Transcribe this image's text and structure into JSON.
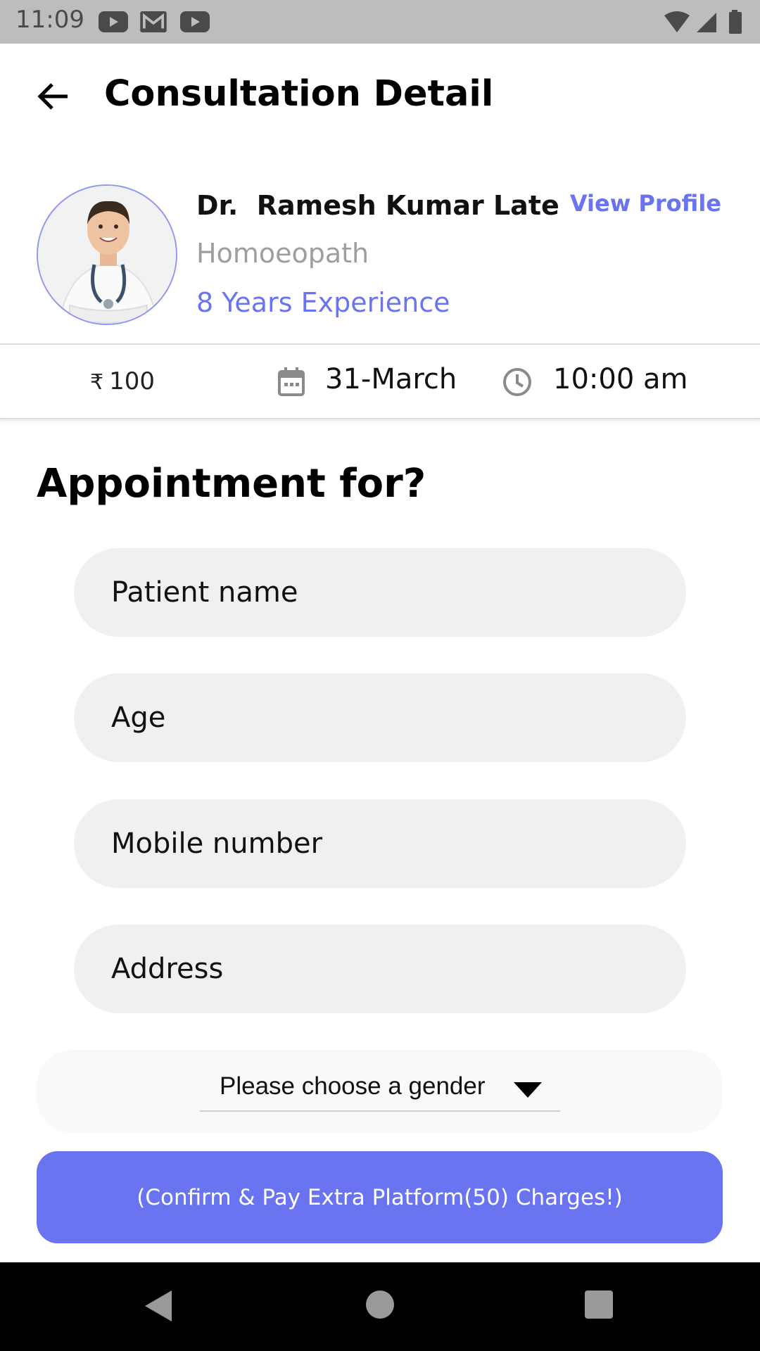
{
  "status_bar": {
    "time": "11:09",
    "left_icons": [
      "youtube-icon",
      "gmail-icon",
      "youtube-icon"
    ],
    "right_icons": [
      "wifi-icon",
      "cellular-signal-icon",
      "battery-icon"
    ]
  },
  "header": {
    "title": "Consultation Detail",
    "back_icon": "arrow-left-icon"
  },
  "doctor": {
    "name": "Dr.  Ramesh Kumar Late",
    "specialty": "Homoeopath",
    "experience": "8 Years Experience",
    "view_profile_label": "View Profile"
  },
  "consultation": {
    "currency_symbol": "₹",
    "fee": "100",
    "date": "31-March",
    "time": "10:00 am"
  },
  "form": {
    "heading": "Appointment for?",
    "patient_name_placeholder": "Patient name",
    "age_placeholder": "Age",
    "mobile_placeholder": "Mobile number",
    "address_placeholder": "Address",
    "gender_placeholder": "Please choose a gender"
  },
  "confirm_button": {
    "label": "(Confirm & Pay Extra Platform(50) Charges!)"
  },
  "colors": {
    "accent": "#6a74f1",
    "muted_text": "#9e9e9e",
    "field_bg": "#f0f0f0",
    "status_bar_bg": "#bdbdbd"
  }
}
